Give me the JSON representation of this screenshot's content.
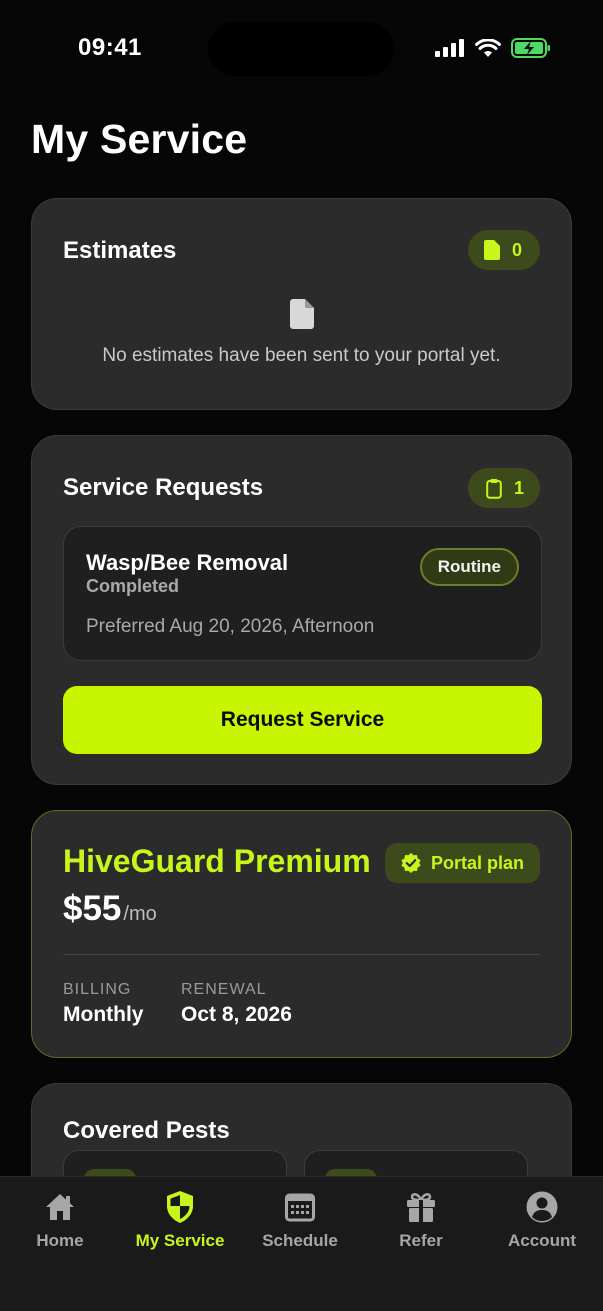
{
  "status_bar": {
    "time": "09:41"
  },
  "page": {
    "title": "My Service"
  },
  "estimates": {
    "title": "Estimates",
    "count": "0",
    "empty_message": "No estimates have been sent to your portal yet."
  },
  "service_requests": {
    "title": "Service Requests",
    "count": "1",
    "items": [
      {
        "title": "Wasp/Bee Removal",
        "status": "Completed",
        "preferred": "Preferred Aug 20, 2026, Afternoon",
        "priority": "Routine"
      }
    ],
    "button_label": "Request Service"
  },
  "plan": {
    "name": "HiveGuard Premium",
    "badge": "Portal plan",
    "price": "$55",
    "price_unit": "/mo",
    "billing_label": "BILLING",
    "billing_value": "Monthly",
    "renewal_label": "RENEWAL",
    "renewal_value": "Oct 8, 2026"
  },
  "covered_pests": {
    "title": "Covered Pests"
  },
  "tabs": [
    {
      "label": "Home",
      "icon": "home-icon"
    },
    {
      "label": "My Service",
      "icon": "shield-icon",
      "active": true
    },
    {
      "label": "Schedule",
      "icon": "calendar-icon"
    },
    {
      "label": "Refer",
      "icon": "gift-icon"
    },
    {
      "label": "Account",
      "icon": "account-icon"
    }
  ],
  "colors": {
    "accent": "#c8f500",
    "background": "#060606",
    "card": "#2b2b2b"
  }
}
